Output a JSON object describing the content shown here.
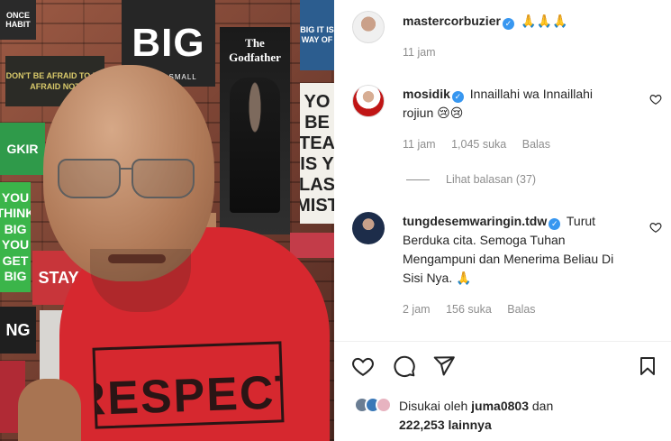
{
  "photo": {
    "posters": {
      "too_big": "BIG",
      "too_big_sub": "THINK SMALL",
      "godfather": "The Godfather",
      "yo_sign": "YO BE TEA IS Y LAS MIST",
      "green": "GKIR",
      "green2": "YOU THINK BIG YOU GET BIG",
      "dark1": "ONCE HABIT",
      "dark2": "DON'T BE AFRAID TO BE AFRAID NOT",
      "stay": "STAY",
      "ng": "NG",
      "blue": "BIG IT IS WAY OF"
    },
    "shirt_text": "RESPECT"
  },
  "post": {
    "caption": {
      "username": "mastercorbuzier",
      "verified": true,
      "text": "🙏🙏🙏",
      "time": "11 jam"
    },
    "comments": [
      {
        "username": "mosidik",
        "verified": true,
        "text": "Innaillahi wa Innaillahi rojiun 😢😢",
        "time": "11 jam",
        "likes": "1,045 suka",
        "reply": "Balas"
      },
      {
        "username": "tungdesemwaringin.tdw",
        "verified": true,
        "text": "Turut Berduka cita. Semoga Tuhan Mengampuni dan Menerima Beliau Di Sisi Nya. 🙏",
        "time": "2 jam",
        "likes": "156 suka",
        "reply": "Balas"
      }
    ],
    "view_replies": "Lihat balasan (37)",
    "liked_by": {
      "prefix": "Disukai oleh",
      "user": "juma0803",
      "and": "dan",
      "others": "222,253 lainnya"
    }
  },
  "icons": [
    "heart-icon",
    "comment-icon",
    "share-icon",
    "bookmark-icon",
    "verified-badge-icon"
  ],
  "colors": {
    "verified": "#3897f0",
    "text": "#262626",
    "muted": "#8e8e8e"
  }
}
